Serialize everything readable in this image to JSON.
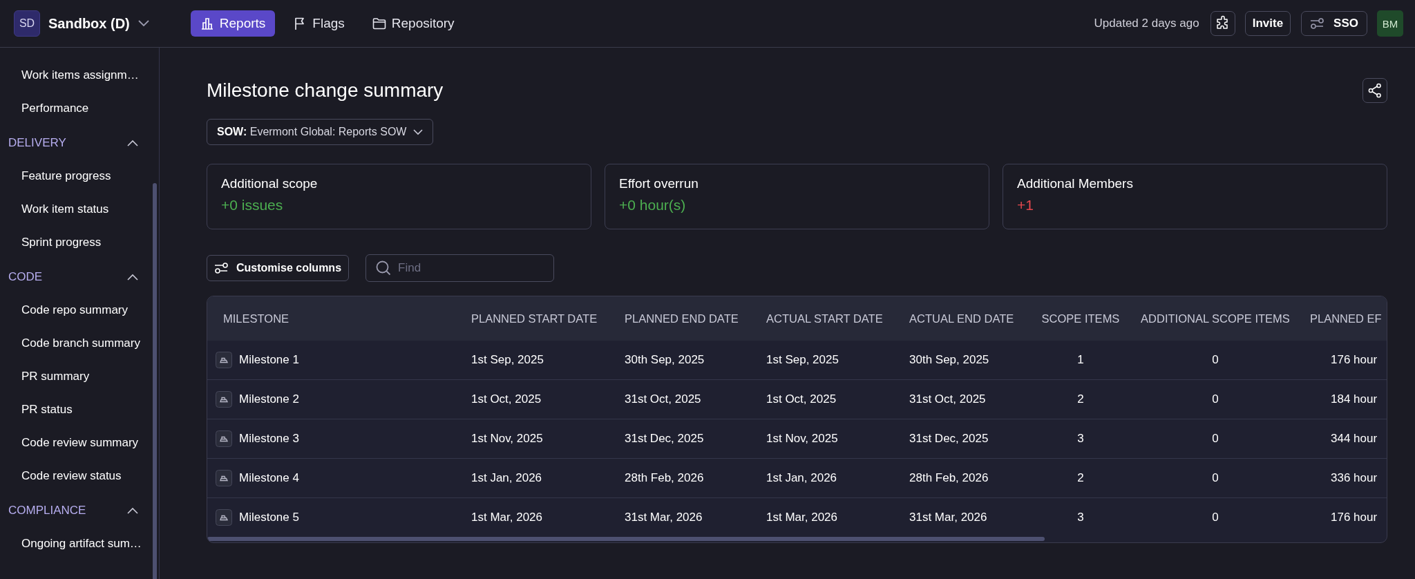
{
  "workspace": {
    "initials": "SD",
    "name": "Sandbox (D)"
  },
  "nav_tabs": [
    {
      "label": "Reports",
      "selected": true
    },
    {
      "label": "Flags",
      "selected": false
    },
    {
      "label": "Repository",
      "selected": false
    }
  ],
  "header_right": {
    "updated": "Updated 2 days ago",
    "invite": "Invite",
    "sso": "SSO",
    "avatar": "BM"
  },
  "sidebar": {
    "top_items": [
      "Work items assignm…",
      "Performance"
    ],
    "sections": [
      {
        "title": "DELIVERY",
        "expanded": true,
        "items": [
          "Feature progress",
          "Work item status",
          "Sprint progress"
        ]
      },
      {
        "title": "CODE",
        "expanded": true,
        "items": [
          "Code repo summary",
          "Code branch summary",
          "PR summary",
          "PR status",
          "Code review summary",
          "Code review status"
        ]
      },
      {
        "title": "COMPLIANCE",
        "expanded": true,
        "items": [
          "Ongoing artifact sum…"
        ]
      }
    ]
  },
  "page": {
    "title": "Milestone change summary",
    "sow_filter": {
      "label": "SOW:",
      "value": "Evermont Global: Reports SOW"
    },
    "summary_cards": [
      {
        "label": "Additional scope",
        "value": "+0 issues",
        "color": "#4caf50"
      },
      {
        "label": "Effort overrun",
        "value": "+0 hour(s)",
        "color": "#4caf50"
      },
      {
        "label": "Additional Members",
        "value": "+1",
        "color": "#e5484d"
      }
    ],
    "customise_button": "Customise columns",
    "search": {
      "placeholder": "Find"
    },
    "table": {
      "columns": [
        "MILESTONE",
        "PLANNED START DATE",
        "PLANNED END DATE",
        "ACTUAL START DATE",
        "ACTUAL END DATE",
        "SCOPE ITEMS",
        "ADDITIONAL SCOPE ITEMS",
        "PLANNED EF"
      ],
      "rows": [
        [
          "Milestone 1",
          "1st Sep, 2025",
          "30th Sep, 2025",
          "1st Sep, 2025",
          "30th Sep, 2025",
          "1",
          "0",
          "176 hour"
        ],
        [
          "Milestone 2",
          "1st Oct, 2025",
          "31st Oct, 2025",
          "1st Oct, 2025",
          "31st Oct, 2025",
          "2",
          "0",
          "184 hour"
        ],
        [
          "Milestone 3",
          "1st Nov, 2025",
          "31st Dec, 2025",
          "1st Nov, 2025",
          "31st Dec, 2025",
          "3",
          "0",
          "344 hour"
        ],
        [
          "Milestone 4",
          "1st Jan, 2026",
          "28th Feb, 2026",
          "1st Jan, 2026",
          "28th Feb, 2026",
          "2",
          "0",
          "336 hour"
        ],
        [
          "Milestone 5",
          "1st Mar, 2026",
          "31st Mar, 2026",
          "1st Mar, 2026",
          "31st Mar, 2026",
          "3",
          "0",
          "176 hour"
        ]
      ]
    }
  }
}
